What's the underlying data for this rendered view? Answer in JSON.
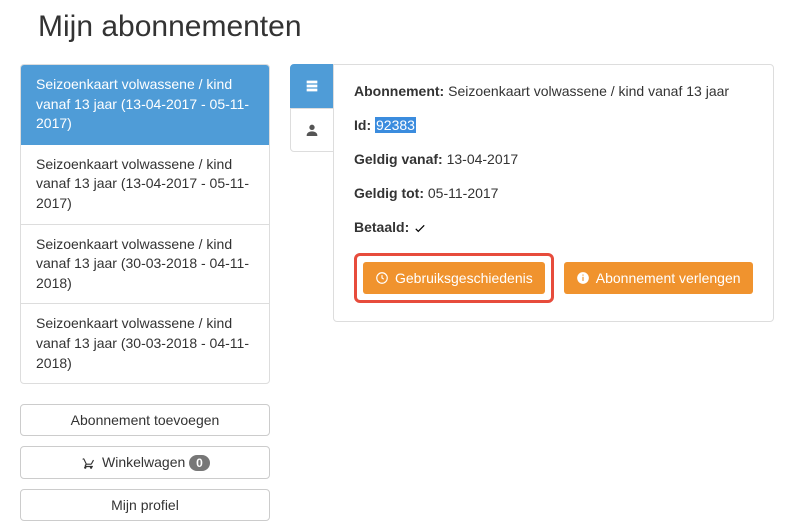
{
  "page_title": "Mijn abonnementen",
  "sidebar": {
    "items": [
      "Seizoenkaart volwassene / kind vanaf 13 jaar (13-04-2017 - 05-11-2017)",
      "Seizoenkaart volwassene / kind vanaf 13 jaar (13-04-2017 - 05-11-2017)",
      "Seizoenkaart volwassene / kind vanaf 13 jaar (30-03-2018 - 04-11-2018)",
      "Seizoenkaart volwassene / kind vanaf 13 jaar (30-03-2018 - 04-11-2018)"
    ],
    "active_index": 0,
    "add_label": "Abonnement toevoegen",
    "cart_label": "Winkelwagen",
    "cart_count": "0",
    "profile_label": "Mijn profiel"
  },
  "detail": {
    "abonnement_label": "Abonnement:",
    "abonnement_value": "Seizoenkaart volwassene / kind vanaf 13 jaar",
    "id_label": "Id:",
    "id_value": "92383",
    "valid_from_label": "Geldig vanaf:",
    "valid_from_value": "13-04-2017",
    "valid_to_label": "Geldig tot:",
    "valid_to_value": "05-11-2017",
    "paid_label": "Betaald:",
    "history_label": "Gebruiksgeschiedenis",
    "extend_label": "Abonnement verlengen"
  }
}
